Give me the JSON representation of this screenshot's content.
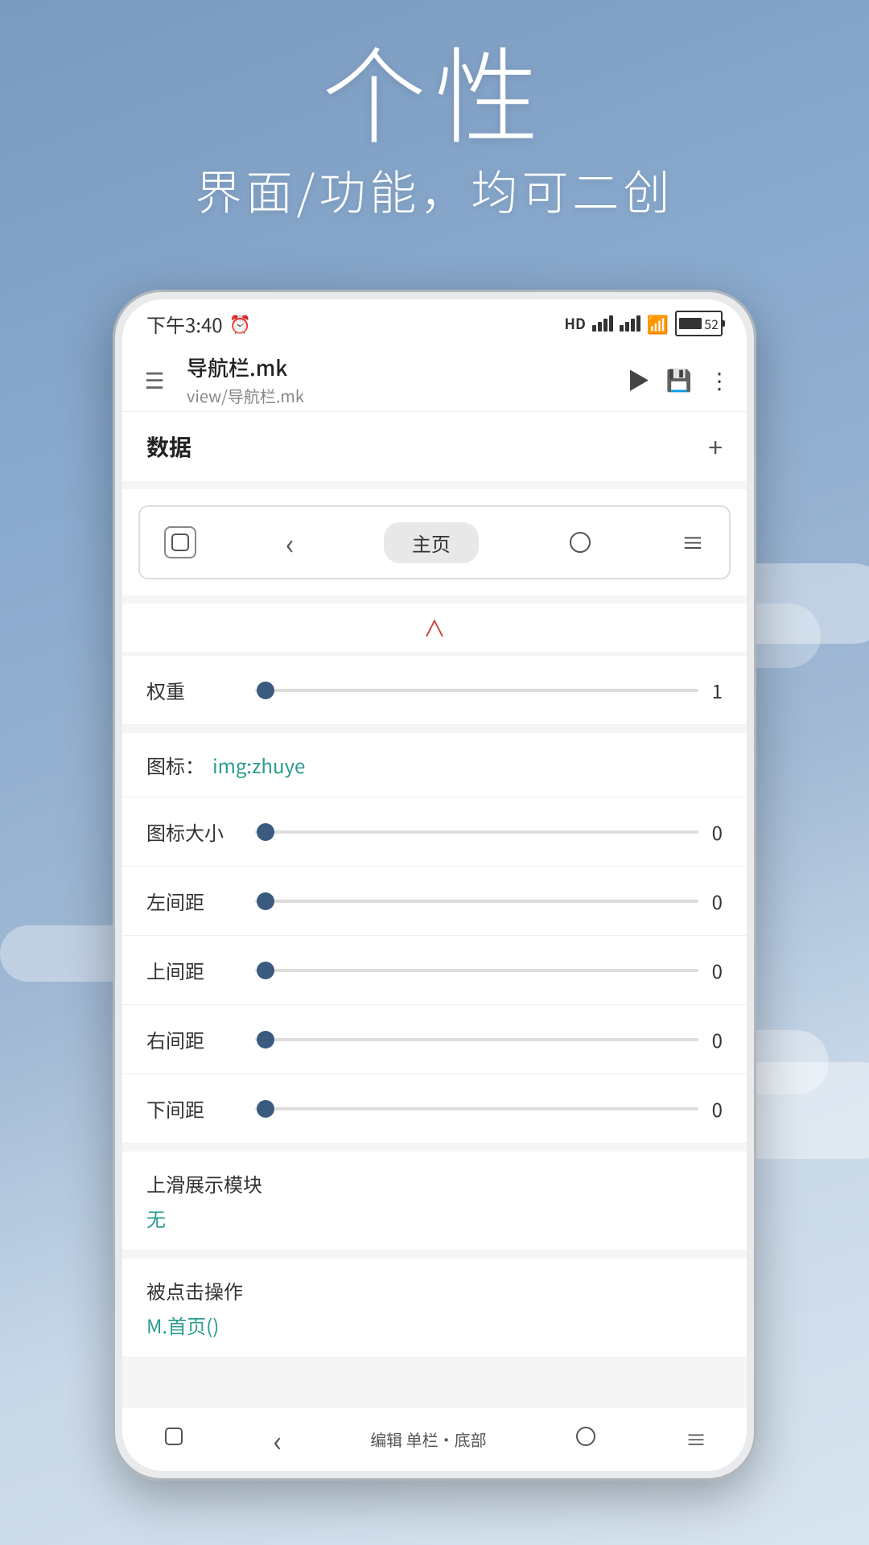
{
  "background": {
    "color_top": "#7a9abf",
    "color_bottom": "#c8d8e8"
  },
  "headline": {
    "main": "个性",
    "sub": "界面/功能，均可二创"
  },
  "status_bar": {
    "time": "下午3:40",
    "battery": "52"
  },
  "toolbar": {
    "title": "导航栏.mk",
    "subtitle": "view/导航栏.mk",
    "run_label": "▶",
    "save_label": "□",
    "more_label": "⋮"
  },
  "data_section": {
    "title": "数据",
    "add_label": "+"
  },
  "nav_demo": {
    "back_icon": "‹",
    "recent_icon": "⌒",
    "home_label": "主页",
    "circle_icon": "○",
    "menu_icon": "≡"
  },
  "settings": {
    "weight": {
      "label": "权重",
      "value": "1"
    },
    "icon": {
      "label": "图标：",
      "value": "img:zhuye"
    },
    "icon_size": {
      "label": "图标大小",
      "value": "0"
    },
    "left_margin": {
      "label": "左间距",
      "value": "0"
    },
    "top_margin": {
      "label": "上间距",
      "value": "0"
    },
    "right_margin": {
      "label": "右间距",
      "value": "0"
    },
    "bottom_margin": {
      "label": "下间距",
      "value": "0"
    },
    "slide_module": {
      "title": "上滑展示模块",
      "value": "无"
    },
    "click_action": {
      "title": "被点击操作",
      "value": "M.首页()"
    }
  },
  "bottom_nav": {
    "recent_icon": "⌒",
    "back_icon": "‹",
    "label": "编辑 单栏·底部",
    "home_icon": "○",
    "menu_icon": "≡"
  }
}
